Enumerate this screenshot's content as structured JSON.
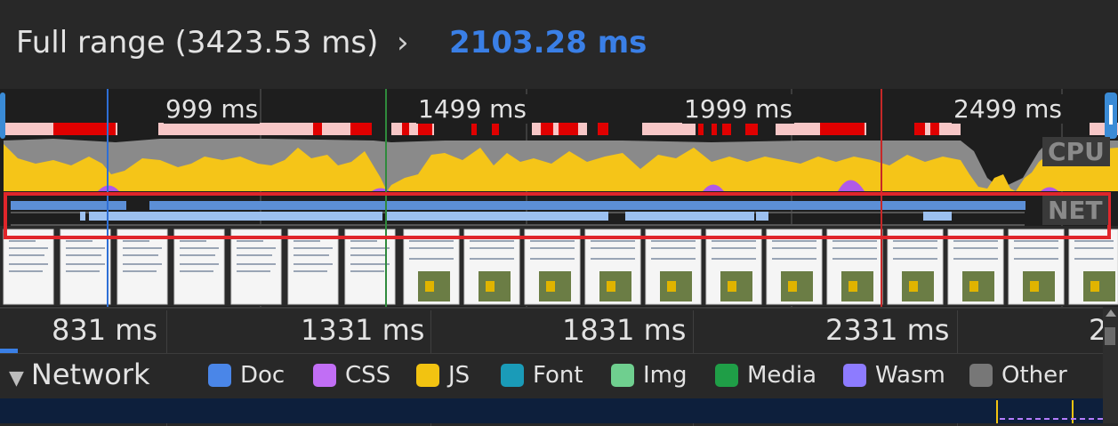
{
  "breadcrumb": {
    "full_range": "Full range (3423.53 ms)",
    "separator": "›",
    "selected_range": "2103.28 ms"
  },
  "overview": {
    "tick_labels": [
      "999 ms",
      "1499 ms",
      "1999 ms",
      "2499 ms"
    ],
    "cpu_label": "CPU",
    "net_label": "NET"
  },
  "ruler": {
    "labels": [
      "831 ms",
      "1331 ms",
      "1831 ms",
      "2331 ms",
      "2"
    ]
  },
  "network": {
    "title": "Network",
    "legend": [
      {
        "label": "Doc",
        "color": "#4a86e8"
      },
      {
        "label": "CSS",
        "color": "#c16ef5"
      },
      {
        "label": "JS",
        "color": "#f2c311"
      },
      {
        "label": "Font",
        "color": "#1a9bb8"
      },
      {
        "label": "Img",
        "color": "#6fcf8f"
      },
      {
        "label": "Media",
        "color": "#1f9e47"
      },
      {
        "label": "Wasm",
        "color": "#8d7bff"
      },
      {
        "label": "Other",
        "color": "#777777"
      }
    ]
  },
  "colors": {
    "selected_range": "#3a7fe6",
    "highlight_box": "#e0262b",
    "cpu_scripting": "#f5c518",
    "cpu_other": "#8a8a8a",
    "net_bar": "#5c8fd6",
    "net_bar_light": "#9cc0ef"
  }
}
